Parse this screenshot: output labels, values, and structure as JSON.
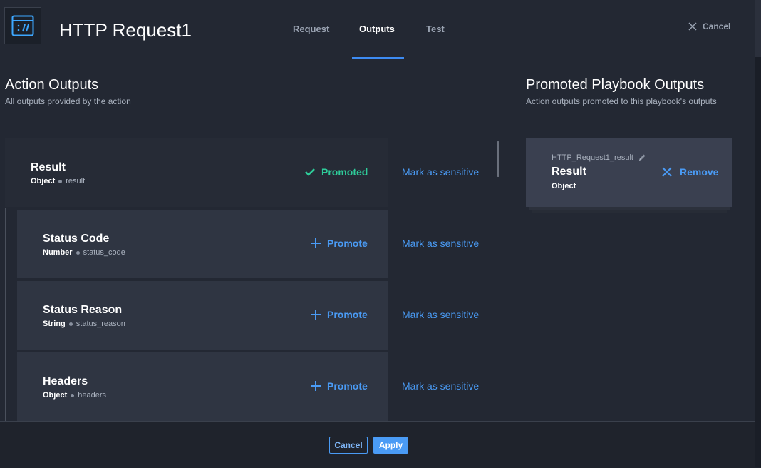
{
  "header": {
    "title": "HTTP Request1",
    "tabs": [
      {
        "label": "Request",
        "active": false
      },
      {
        "label": "Outputs",
        "active": true
      },
      {
        "label": "Test",
        "active": false
      }
    ],
    "cancel_label": "Cancel"
  },
  "action_outputs": {
    "title": "Action Outputs",
    "subtitle": "All outputs provided by the action",
    "items": [
      {
        "name": "Result",
        "type": "Object",
        "key": "result",
        "action": "Promoted",
        "sensitive": "Mark as sensitive"
      },
      {
        "name": "Status Code",
        "type": "Number",
        "key": "status_code",
        "action": "Promote",
        "sensitive": "Mark as sensitive"
      },
      {
        "name": "Status Reason",
        "type": "String",
        "key": "status_reason",
        "action": "Promote",
        "sensitive": "Mark as sensitive"
      },
      {
        "name": "Headers",
        "type": "Object",
        "key": "headers",
        "action": "Promote",
        "sensitive": "Mark as sensitive"
      }
    ]
  },
  "promoted_outputs": {
    "title": "Promoted Playbook Outputs",
    "subtitle": "Action outputs promoted to this playbook's outputs",
    "items": [
      {
        "variable": "HTTP_Request1_result",
        "name": "Result",
        "type": "Object",
        "remove_label": "Remove"
      }
    ]
  },
  "footer": {
    "cancel_label": "Cancel",
    "apply_label": "Apply"
  },
  "colors": {
    "accent": "#4a9bf5",
    "promoted": "#2ecc9a",
    "background": "#232833"
  }
}
